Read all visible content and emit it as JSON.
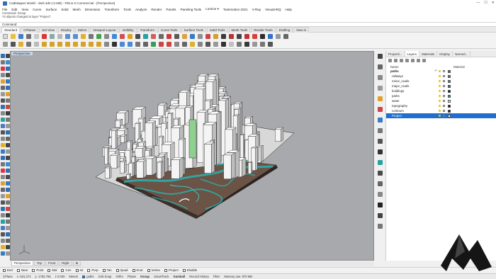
{
  "window": {
    "title": "CadMapper Model - dark.3dm (4 MB) - Rhino 6 Commercial - [Perspective]",
    "controls": [
      "—",
      "☐",
      "✕"
    ]
  },
  "menu": [
    "File",
    "Edit",
    "View",
    "Curve",
    "Surface",
    "Solid",
    "Mesh",
    "Dimension",
    "Transform",
    "Tools",
    "Analyze",
    "Render",
    "Panels",
    "Paneling Tools",
    "Lumion ▾",
    "Twinmotion 2021",
    "V-Ray",
    "VisualARQ",
    "Help"
  ],
  "command_history": [
    "Command: Group",
    "74 objects changed to layer \"Project\"."
  ],
  "command_prompt": "Command:",
  "toolbar_tabs": [
    "Standard",
    "CPlanes",
    "Set View",
    "Display",
    "Select",
    "Viewport Layout",
    "Visibility",
    "Transform",
    "Curve Tools",
    "Surface Tools",
    "Solid Tools",
    "Mesh Tools",
    "Render Tools",
    "Drafting",
    "New in"
  ],
  "viewport": {
    "label": "Perspective",
    "tabs": [
      "Perspective",
      "Top",
      "Front",
      "Right",
      "⊕"
    ]
  },
  "osnaps": [
    "End",
    "Near",
    "Point",
    "Mid",
    "Cen",
    "Int",
    "Perp",
    "Tan",
    "Quad",
    "Knot",
    "Vertex",
    "Project",
    "Disable"
  ],
  "statusbar": {
    "cplane": "CPlane",
    "x": "x -531.274",
    "y": "y -1782.765",
    "z": "z 0.000",
    "units": "Meters",
    "layer": "paths",
    "toggles": [
      "Grid Snap",
      "Ortho",
      "Planar",
      "Osnap",
      "SmartTrack",
      "Gumball",
      "Record History",
      "Filter"
    ],
    "memory": "Memory use: 970 MB"
  },
  "panel": {
    "tabs": [
      "Properti...",
      "Layers",
      "Materials",
      "Display",
      "Named..."
    ],
    "columns": {
      "name": "Name",
      "material": "Material"
    },
    "layers": [
      {
        "name": "paths",
        "bold": true,
        "current": true,
        "color": "#2f7f6f"
      },
      {
        "name": "railways",
        "color": "#6f6f6f"
      },
      {
        "name": "minor_roads",
        "color": "#3a8fb0"
      },
      {
        "name": "major_roads",
        "color": "#1f5f80"
      },
      {
        "name": "buildings",
        "color": "#101010"
      },
      {
        "name": "parks",
        "color": "#3a9a3a"
      },
      {
        "name": "water",
        "color": "#e6e6e6"
      },
      {
        "name": "topography",
        "color": "#101010"
      },
      {
        "name": "contours",
        "color": "#1c1c1c"
      },
      {
        "name": "Project",
        "selected": true,
        "color": "#ffffff"
      }
    ]
  },
  "colors": {
    "viewport_bg": "#a8a9ad",
    "selection": "#1e6fd0",
    "accent_teal": "#2ab3b1",
    "terrain": "#6b5346"
  }
}
